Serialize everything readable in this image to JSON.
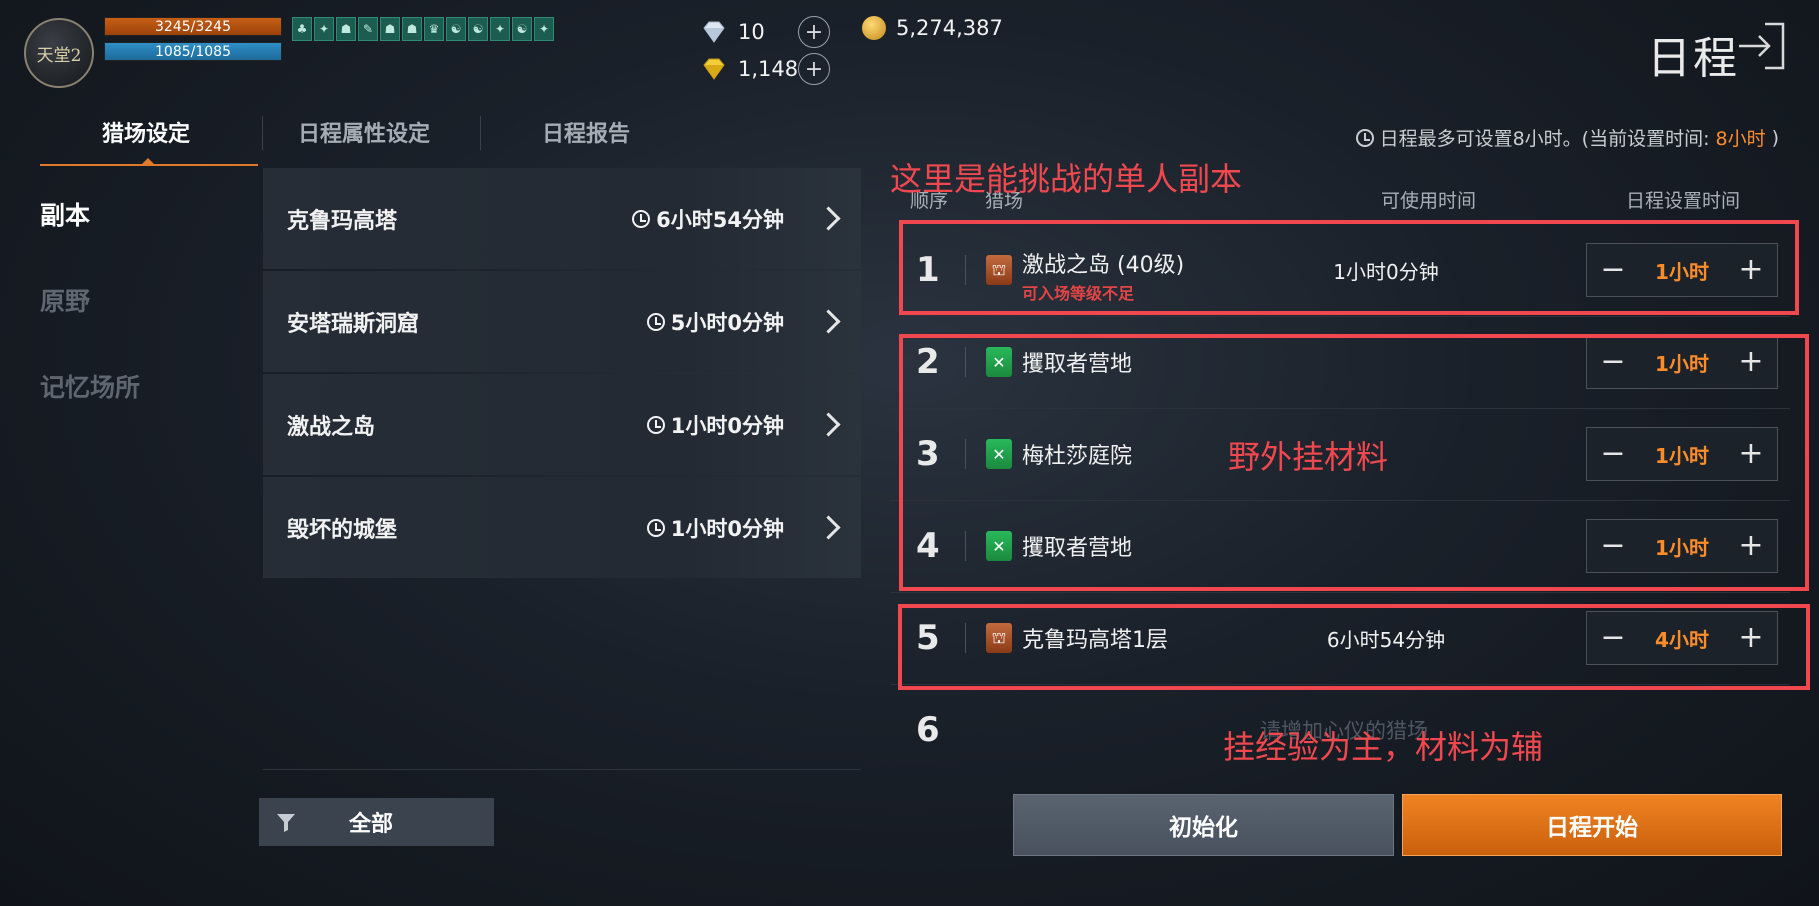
{
  "player": {
    "avatar_text": "天堂2",
    "hp": "3245/3245",
    "mp": "1085/1085",
    "buffs": [
      "♣",
      "✦",
      "☗",
      "✎",
      "☗",
      "☗",
      "♛",
      "☯",
      "☯",
      "✦",
      "☯",
      "✦"
    ]
  },
  "currency": {
    "diamond": "10",
    "gold": "5,274,387",
    "gem": "1,148"
  },
  "page_title": "日程",
  "tabs": [
    "猎场设定",
    "日程属性设定",
    "日程报告"
  ],
  "limit_notice": {
    "prefix": "日程最多可设置8小时。(当前设置时间:",
    "current": "8小时",
    "suffix": ")"
  },
  "categories": [
    "副本",
    "原野",
    "记忆场所"
  ],
  "dungeons": [
    {
      "name": "克鲁玛高塔",
      "time": "6小时54分钟"
    },
    {
      "name": "安塔瑞斯洞窟",
      "time": "5小时0分钟"
    },
    {
      "name": "激战之岛",
      "time": "1小时0分钟"
    },
    {
      "name": "毁坏的城堡",
      "time": "1小时0分钟"
    }
  ],
  "filter_label": "全部",
  "table_headers": {
    "order": "顺序",
    "field": "猎场",
    "available": "可使用时间",
    "set_time": "日程设置时间"
  },
  "rows": [
    {
      "num": "1",
      "type": "dungeon",
      "name": "激战之岛 (40级)",
      "warning": "可入场等级不足",
      "available": "1小时0分钟",
      "value": "1小时"
    },
    {
      "num": "2",
      "type": "field",
      "name": "攫取者营地",
      "warning": "",
      "available": "",
      "value": "1小时"
    },
    {
      "num": "3",
      "type": "field",
      "name": "梅杜莎庭院",
      "warning": "",
      "available": "",
      "value": "1小时"
    },
    {
      "num": "4",
      "type": "field",
      "name": "攫取者营地",
      "warning": "",
      "available": "",
      "value": "1小时"
    },
    {
      "num": "5",
      "type": "dungeon",
      "name": "克鲁玛高塔1层",
      "warning": "",
      "available": "6小时54分钟",
      "value": "4小时"
    },
    {
      "num": "6",
      "type": "empty",
      "name": "",
      "warning": "",
      "available": "",
      "value": "",
      "placeholder": "请增加心仪的猎场"
    }
  ],
  "stepper": {
    "minus": "−",
    "plus": "+"
  },
  "buttons": {
    "reset": "初始化",
    "start": "日程开始"
  },
  "annotations": {
    "solo_dungeon": "这里是能挑战的单人副本",
    "field_material": "野外挂材料",
    "exp_main": "挂经验为主，材料为辅"
  },
  "colors": {
    "accent": "#ff8c2a",
    "annotation": "#f0484e",
    "field_icon": "#29b85c",
    "dungeon_icon": "#c36b3e"
  }
}
